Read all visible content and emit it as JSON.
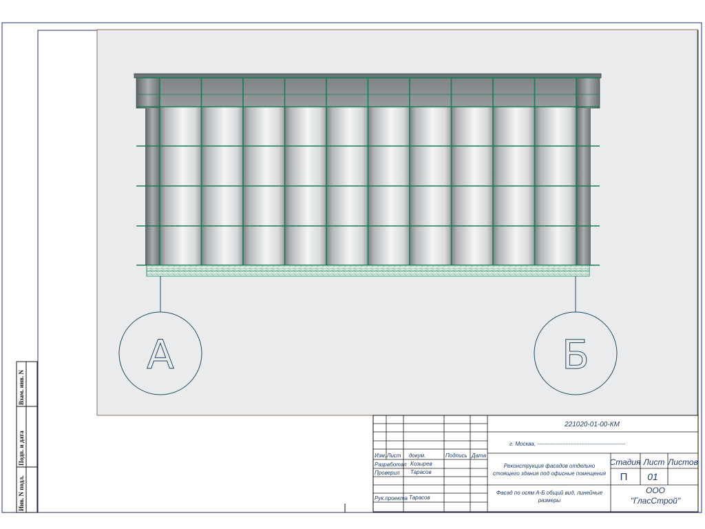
{
  "drawing": {
    "axis_left_label": "А",
    "axis_right_label": "Б",
    "panel_columns": 10,
    "panel_rows": 5
  },
  "side_stamp": {
    "box1": "Взам. инв. N",
    "box2": "Подп. и дата",
    "box3": "Инв. N подл."
  },
  "title_block": {
    "doc_code": "221020-01-00-КМ",
    "city_line": "г. Москва, ------------------------------------------------",
    "headers": {
      "izm": "Изм.",
      "list": "Лист",
      "doc": "докум.",
      "sign": "Подпись",
      "date": "Дата"
    },
    "roles": {
      "developed": "Разработал",
      "checked": "Проверил",
      "lead": "Рук.проекта"
    },
    "names": {
      "developed": "Козырев",
      "checked": "Тарасов",
      "lead": "Тарасов"
    },
    "project_line1": "Реконструкция фасадов отдельно",
    "project_line2": "стоящего здания под офисные помещения",
    "sheet_line1": "Фасад по осям А-Б общий вид,  линейные",
    "sheet_line2": "размеры",
    "col_stage": "Стадия",
    "col_sheet": "Лист",
    "col_sheets": "Листов",
    "stage": "П",
    "sheet_no": "01",
    "org_line1": "ООО",
    "org_line2": "\"ГласСтрой\""
  },
  "colors": {
    "frame": "#1e2d63",
    "grid": "#1a7a55",
    "paper": "#e9ebec",
    "axis": "#1e4a60"
  }
}
